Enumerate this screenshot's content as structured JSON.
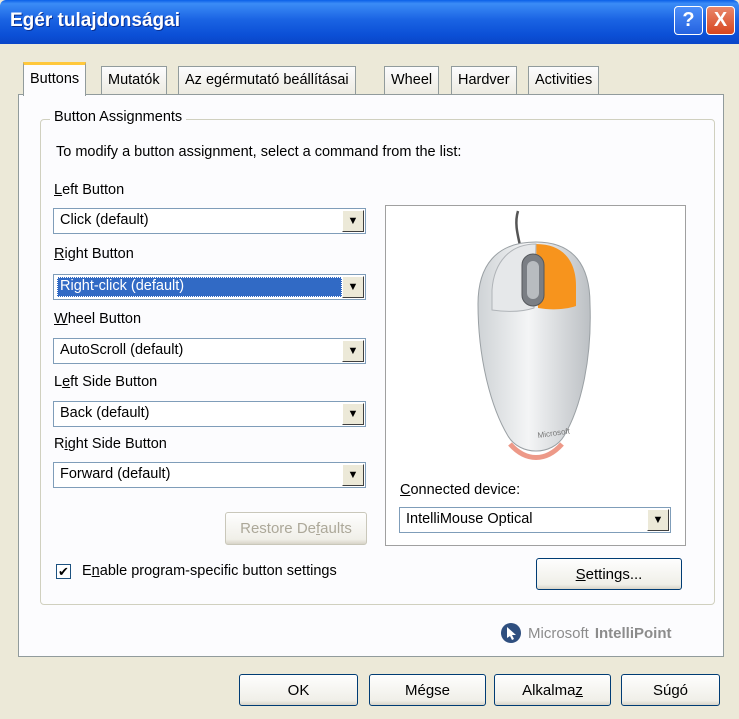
{
  "window": {
    "title": "Egér tulajdonságai",
    "help_label": "?",
    "close_label": "X"
  },
  "tabs": [
    {
      "label": "Buttons",
      "active": true
    },
    {
      "label": "Mutatók"
    },
    {
      "label": "Az egérmutató beállításai"
    },
    {
      "label": "Wheel"
    },
    {
      "label": "Hardver"
    },
    {
      "label": "Activities"
    }
  ],
  "group": {
    "legend": "Button Assignments",
    "instructions": "To modify a button assignment, select a command from the list:"
  },
  "assignments": [
    {
      "label": "Left Button",
      "value": "Click (default)"
    },
    {
      "label": "Right Button",
      "value": "Right-click (default)"
    },
    {
      "label": "Wheel Button",
      "value": "AutoScroll (default)"
    },
    {
      "label": "Left Side Button",
      "value": "Back (default)"
    },
    {
      "label": "Right Side Button",
      "value": "Forward (default)"
    }
  ],
  "restore_label": "Restore Defaults",
  "device": {
    "label": "Connected device:",
    "value": "IntelliMouse Optical",
    "mouse_brand": "Microsoft",
    "highlight_color": "#f7941d"
  },
  "checkbox": {
    "label": "Enable program-specific button settings",
    "checked": true
  },
  "settings_label": "Settings...",
  "branding": {
    "part1": "Microsoft",
    "part2": "IntelliPoint"
  },
  "footer": {
    "ok_label": "OK",
    "cancel_label": "Mégse",
    "apply_label": "Alkalmaz",
    "help_label": "Súgó"
  },
  "colors": {
    "titlebar": "#0a5fe8",
    "selection": "#316ac5",
    "tab_highlight": "#ffc83c"
  }
}
